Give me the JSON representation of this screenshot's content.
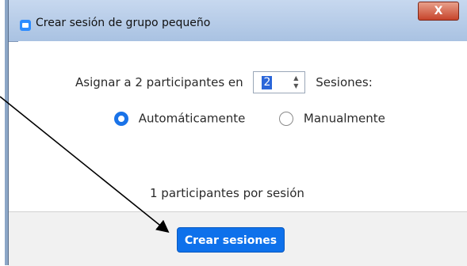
{
  "window": {
    "title": "Crear sesión de grupo pequeño",
    "close_glyph": "X",
    "icon": "zoom-app-icon"
  },
  "assign": {
    "prefix": "Asignar a 2 participantes en",
    "value": "2",
    "suffix": "Sesiones:"
  },
  "options": [
    {
      "label": "Automáticamente",
      "selected": true
    },
    {
      "label": "Manualmente",
      "selected": false
    }
  ],
  "summary": "1 participantes por sesión",
  "footer": {
    "create_label": "Crear sesiones"
  },
  "colors": {
    "accent": "#0e71eb",
    "annotation_arrow": "#000000"
  }
}
